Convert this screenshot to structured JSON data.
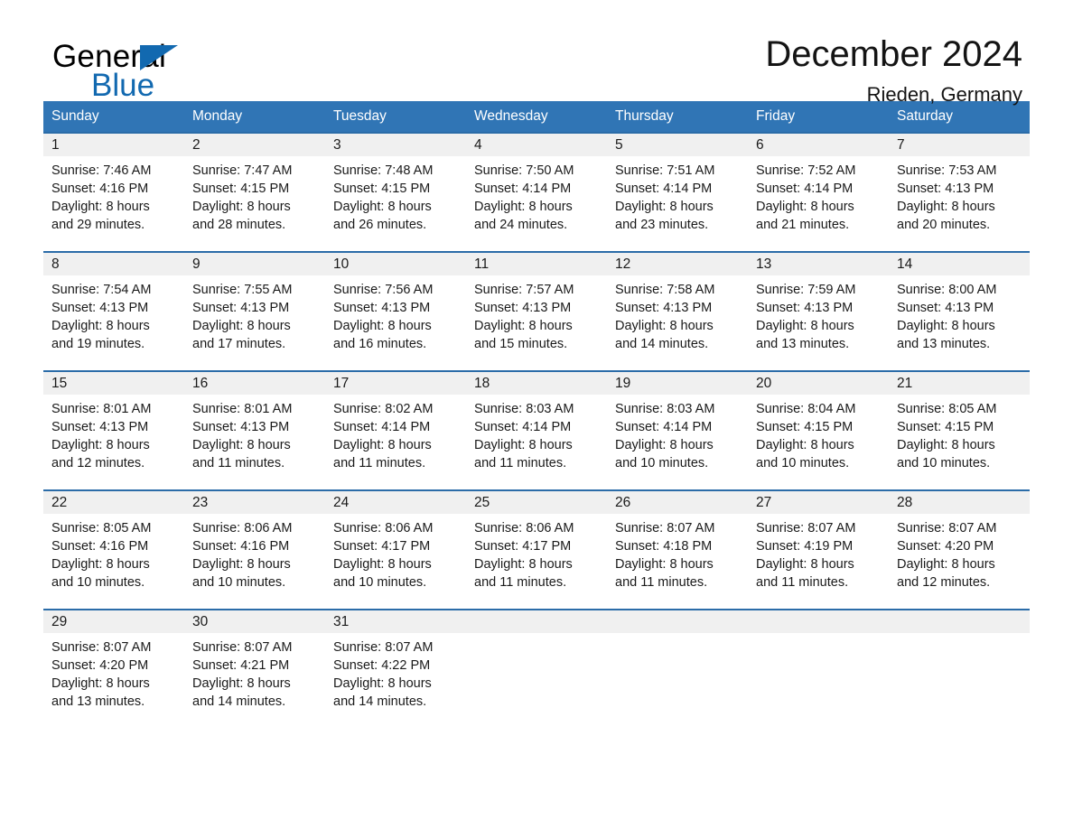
{
  "brand": {
    "word_general": "General",
    "word_blue": "Blue",
    "logo_icon": "triangle-flag-icon",
    "accent_color": "#1269b0"
  },
  "header": {
    "title": "December 2024",
    "location": "Rieden, Germany"
  },
  "calendar": {
    "header_bg": "#3075b5",
    "row_border_color": "#2b6ca8",
    "daynum_band_bg": "#f0f0f0",
    "weekday_headers": [
      "Sunday",
      "Monday",
      "Tuesday",
      "Wednesday",
      "Thursday",
      "Friday",
      "Saturday"
    ],
    "weeks": [
      [
        {
          "day": "1",
          "sunrise": "Sunrise: 7:46 AM",
          "sunset": "Sunset: 4:16 PM",
          "daylight_1": "Daylight: 8 hours",
          "daylight_2": "and 29 minutes."
        },
        {
          "day": "2",
          "sunrise": "Sunrise: 7:47 AM",
          "sunset": "Sunset: 4:15 PM",
          "daylight_1": "Daylight: 8 hours",
          "daylight_2": "and 28 minutes."
        },
        {
          "day": "3",
          "sunrise": "Sunrise: 7:48 AM",
          "sunset": "Sunset: 4:15 PM",
          "daylight_1": "Daylight: 8 hours",
          "daylight_2": "and 26 minutes."
        },
        {
          "day": "4",
          "sunrise": "Sunrise: 7:50 AM",
          "sunset": "Sunset: 4:14 PM",
          "daylight_1": "Daylight: 8 hours",
          "daylight_2": "and 24 minutes."
        },
        {
          "day": "5",
          "sunrise": "Sunrise: 7:51 AM",
          "sunset": "Sunset: 4:14 PM",
          "daylight_1": "Daylight: 8 hours",
          "daylight_2": "and 23 minutes."
        },
        {
          "day": "6",
          "sunrise": "Sunrise: 7:52 AM",
          "sunset": "Sunset: 4:14 PM",
          "daylight_1": "Daylight: 8 hours",
          "daylight_2": "and 21 minutes."
        },
        {
          "day": "7",
          "sunrise": "Sunrise: 7:53 AM",
          "sunset": "Sunset: 4:13 PM",
          "daylight_1": "Daylight: 8 hours",
          "daylight_2": "and 20 minutes."
        }
      ],
      [
        {
          "day": "8",
          "sunrise": "Sunrise: 7:54 AM",
          "sunset": "Sunset: 4:13 PM",
          "daylight_1": "Daylight: 8 hours",
          "daylight_2": "and 19 minutes."
        },
        {
          "day": "9",
          "sunrise": "Sunrise: 7:55 AM",
          "sunset": "Sunset: 4:13 PM",
          "daylight_1": "Daylight: 8 hours",
          "daylight_2": "and 17 minutes."
        },
        {
          "day": "10",
          "sunrise": "Sunrise: 7:56 AM",
          "sunset": "Sunset: 4:13 PM",
          "daylight_1": "Daylight: 8 hours",
          "daylight_2": "and 16 minutes."
        },
        {
          "day": "11",
          "sunrise": "Sunrise: 7:57 AM",
          "sunset": "Sunset: 4:13 PM",
          "daylight_1": "Daylight: 8 hours",
          "daylight_2": "and 15 minutes."
        },
        {
          "day": "12",
          "sunrise": "Sunrise: 7:58 AM",
          "sunset": "Sunset: 4:13 PM",
          "daylight_1": "Daylight: 8 hours",
          "daylight_2": "and 14 minutes."
        },
        {
          "day": "13",
          "sunrise": "Sunrise: 7:59 AM",
          "sunset": "Sunset: 4:13 PM",
          "daylight_1": "Daylight: 8 hours",
          "daylight_2": "and 13 minutes."
        },
        {
          "day": "14",
          "sunrise": "Sunrise: 8:00 AM",
          "sunset": "Sunset: 4:13 PM",
          "daylight_1": "Daylight: 8 hours",
          "daylight_2": "and 13 minutes."
        }
      ],
      [
        {
          "day": "15",
          "sunrise": "Sunrise: 8:01 AM",
          "sunset": "Sunset: 4:13 PM",
          "daylight_1": "Daylight: 8 hours",
          "daylight_2": "and 12 minutes."
        },
        {
          "day": "16",
          "sunrise": "Sunrise: 8:01 AM",
          "sunset": "Sunset: 4:13 PM",
          "daylight_1": "Daylight: 8 hours",
          "daylight_2": "and 11 minutes."
        },
        {
          "day": "17",
          "sunrise": "Sunrise: 8:02 AM",
          "sunset": "Sunset: 4:14 PM",
          "daylight_1": "Daylight: 8 hours",
          "daylight_2": "and 11 minutes."
        },
        {
          "day": "18",
          "sunrise": "Sunrise: 8:03 AM",
          "sunset": "Sunset: 4:14 PM",
          "daylight_1": "Daylight: 8 hours",
          "daylight_2": "and 11 minutes."
        },
        {
          "day": "19",
          "sunrise": "Sunrise: 8:03 AM",
          "sunset": "Sunset: 4:14 PM",
          "daylight_1": "Daylight: 8 hours",
          "daylight_2": "and 10 minutes."
        },
        {
          "day": "20",
          "sunrise": "Sunrise: 8:04 AM",
          "sunset": "Sunset: 4:15 PM",
          "daylight_1": "Daylight: 8 hours",
          "daylight_2": "and 10 minutes."
        },
        {
          "day": "21",
          "sunrise": "Sunrise: 8:05 AM",
          "sunset": "Sunset: 4:15 PM",
          "daylight_1": "Daylight: 8 hours",
          "daylight_2": "and 10 minutes."
        }
      ],
      [
        {
          "day": "22",
          "sunrise": "Sunrise: 8:05 AM",
          "sunset": "Sunset: 4:16 PM",
          "daylight_1": "Daylight: 8 hours",
          "daylight_2": "and 10 minutes."
        },
        {
          "day": "23",
          "sunrise": "Sunrise: 8:06 AM",
          "sunset": "Sunset: 4:16 PM",
          "daylight_1": "Daylight: 8 hours",
          "daylight_2": "and 10 minutes."
        },
        {
          "day": "24",
          "sunrise": "Sunrise: 8:06 AM",
          "sunset": "Sunset: 4:17 PM",
          "daylight_1": "Daylight: 8 hours",
          "daylight_2": "and 10 minutes."
        },
        {
          "day": "25",
          "sunrise": "Sunrise: 8:06 AM",
          "sunset": "Sunset: 4:17 PM",
          "daylight_1": "Daylight: 8 hours",
          "daylight_2": "and 11 minutes."
        },
        {
          "day": "26",
          "sunrise": "Sunrise: 8:07 AM",
          "sunset": "Sunset: 4:18 PM",
          "daylight_1": "Daylight: 8 hours",
          "daylight_2": "and 11 minutes."
        },
        {
          "day": "27",
          "sunrise": "Sunrise: 8:07 AM",
          "sunset": "Sunset: 4:19 PM",
          "daylight_1": "Daylight: 8 hours",
          "daylight_2": "and 11 minutes."
        },
        {
          "day": "28",
          "sunrise": "Sunrise: 8:07 AM",
          "sunset": "Sunset: 4:20 PM",
          "daylight_1": "Daylight: 8 hours",
          "daylight_2": "and 12 minutes."
        }
      ],
      [
        {
          "day": "29",
          "sunrise": "Sunrise: 8:07 AM",
          "sunset": "Sunset: 4:20 PM",
          "daylight_1": "Daylight: 8 hours",
          "daylight_2": "and 13 minutes."
        },
        {
          "day": "30",
          "sunrise": "Sunrise: 8:07 AM",
          "sunset": "Sunset: 4:21 PM",
          "daylight_1": "Daylight: 8 hours",
          "daylight_2": "and 14 minutes."
        },
        {
          "day": "31",
          "sunrise": "Sunrise: 8:07 AM",
          "sunset": "Sunset: 4:22 PM",
          "daylight_1": "Daylight: 8 hours",
          "daylight_2": "and 14 minutes."
        },
        {
          "day": "",
          "sunrise": "",
          "sunset": "",
          "daylight_1": "",
          "daylight_2": ""
        },
        {
          "day": "",
          "sunrise": "",
          "sunset": "",
          "daylight_1": "",
          "daylight_2": ""
        },
        {
          "day": "",
          "sunrise": "",
          "sunset": "",
          "daylight_1": "",
          "daylight_2": ""
        },
        {
          "day": "",
          "sunrise": "",
          "sunset": "",
          "daylight_1": "",
          "daylight_2": ""
        }
      ]
    ]
  }
}
